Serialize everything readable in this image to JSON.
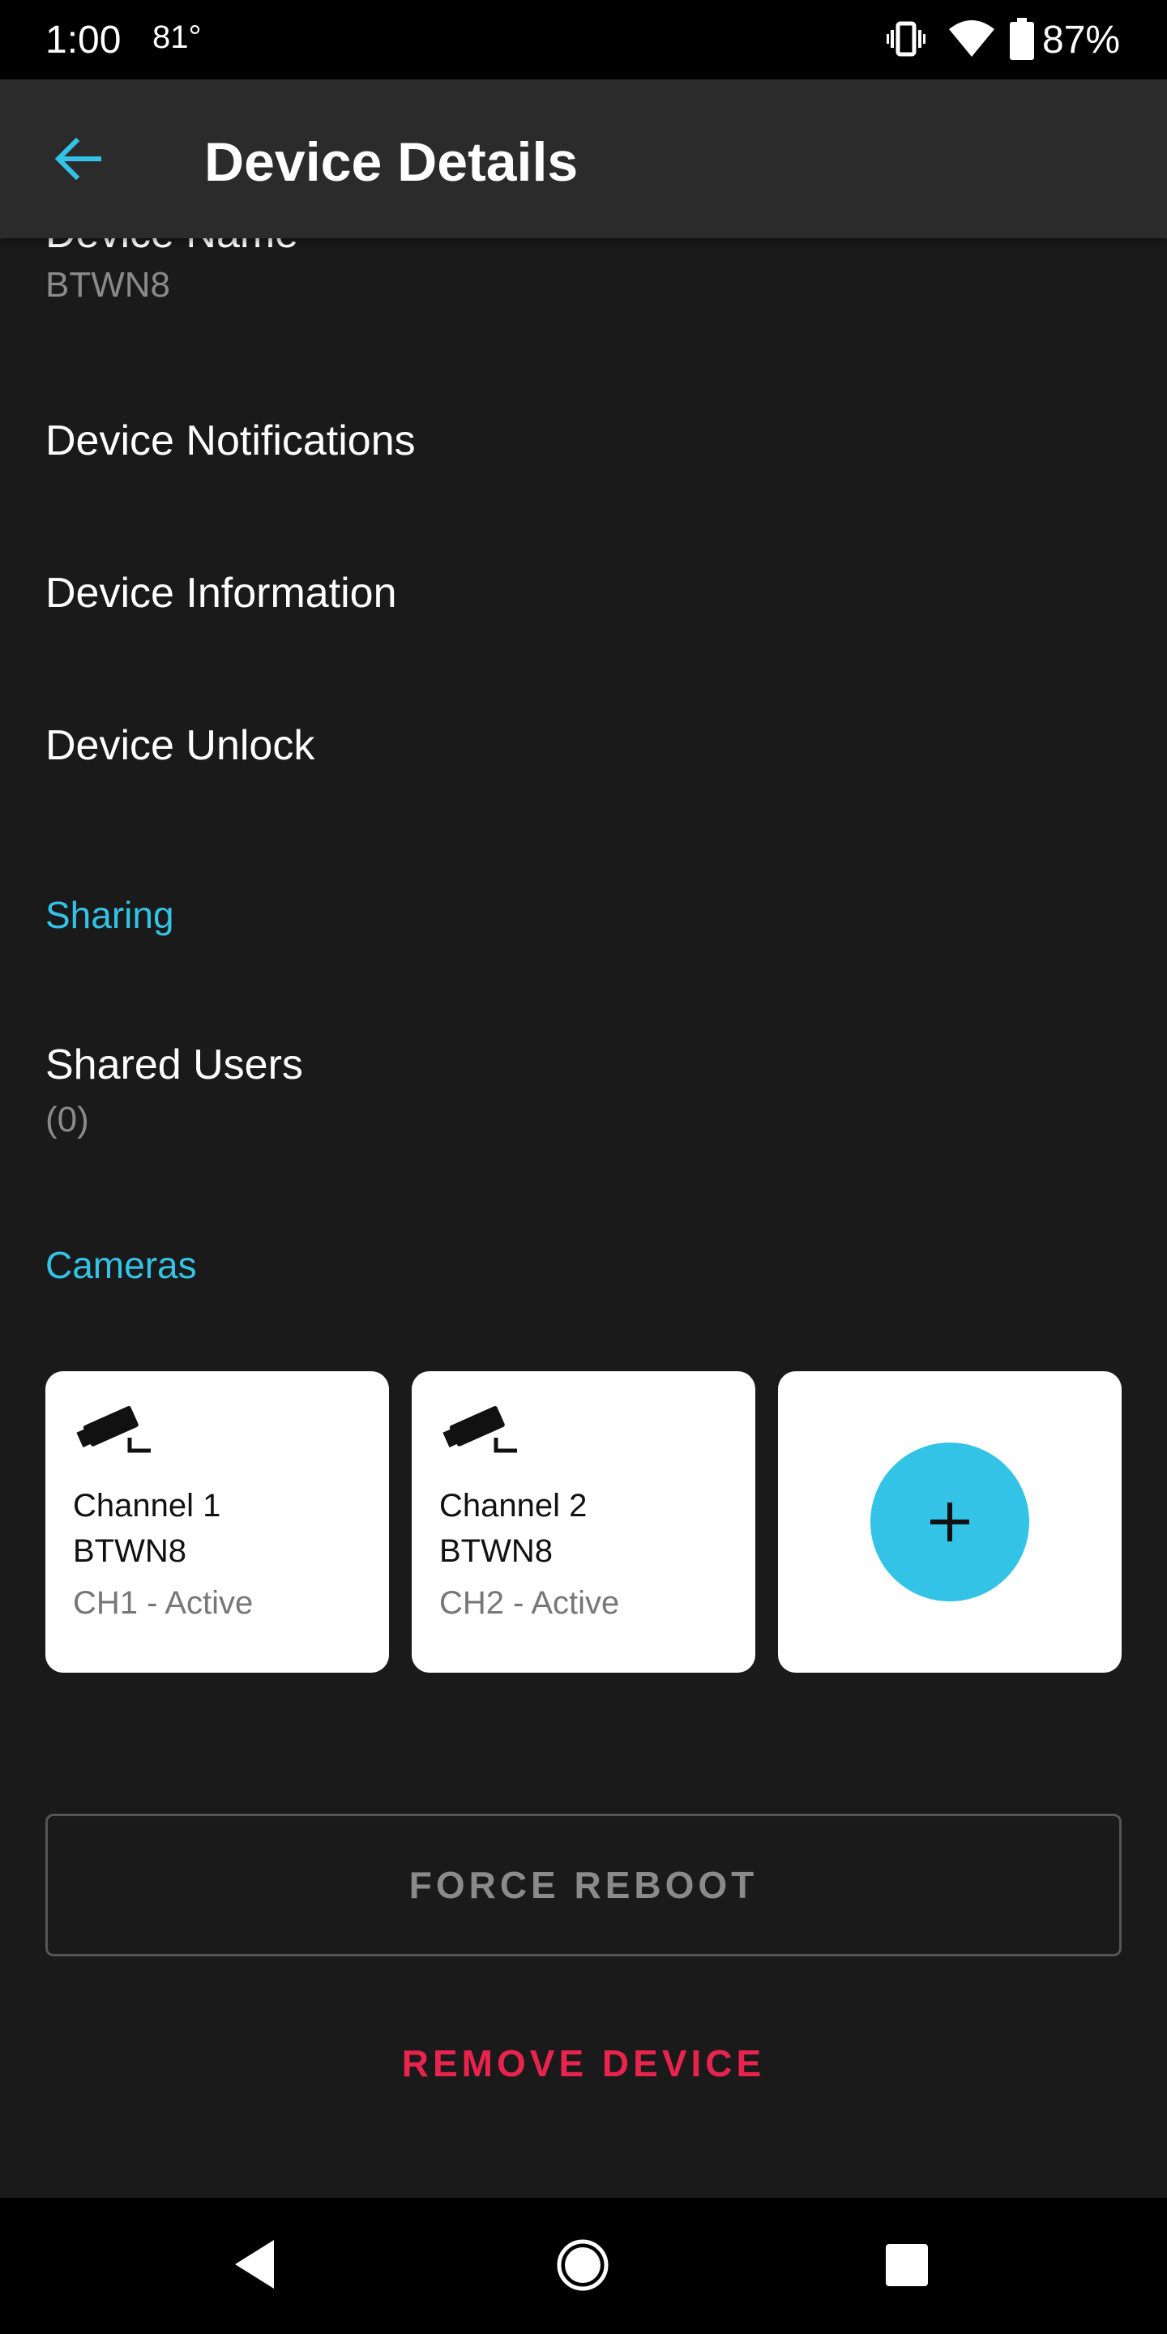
{
  "status_bar": {
    "time": "1:00",
    "temperature": "81°",
    "battery_percent": "87%"
  },
  "app_bar": {
    "title": "Device Details"
  },
  "settings": {
    "device_name_label": "Device Name",
    "device_name_value": "BTWN8",
    "notifications_label": "Device Notifications",
    "information_label": "Device Information",
    "unlock_label": "Device Unlock"
  },
  "sharing": {
    "header": "Sharing",
    "shared_users_label": "Shared Users",
    "shared_users_count": "(0)"
  },
  "cameras": {
    "header": "Cameras",
    "cards": [
      {
        "name": "Channel 1",
        "device": "BTWN8",
        "status": "CH1 - Active"
      },
      {
        "name": "Channel 2",
        "device": "BTWN8",
        "status": "CH2 - Active"
      }
    ]
  },
  "actions": {
    "force_reboot": "FORCE REBOOT",
    "remove_device": "REMOVE DEVICE"
  },
  "colors": {
    "accent": "#33c3e6",
    "danger": "#e8234d",
    "background": "#1a1a1a",
    "app_bar": "#2b2b2b"
  },
  "icons": {
    "back": "arrow-left-icon",
    "camera": "security-camera-icon",
    "add": "plus-icon",
    "nav_back": "triangle-back-icon",
    "nav_home": "circle-home-icon",
    "nav_recents": "square-recents-icon"
  }
}
